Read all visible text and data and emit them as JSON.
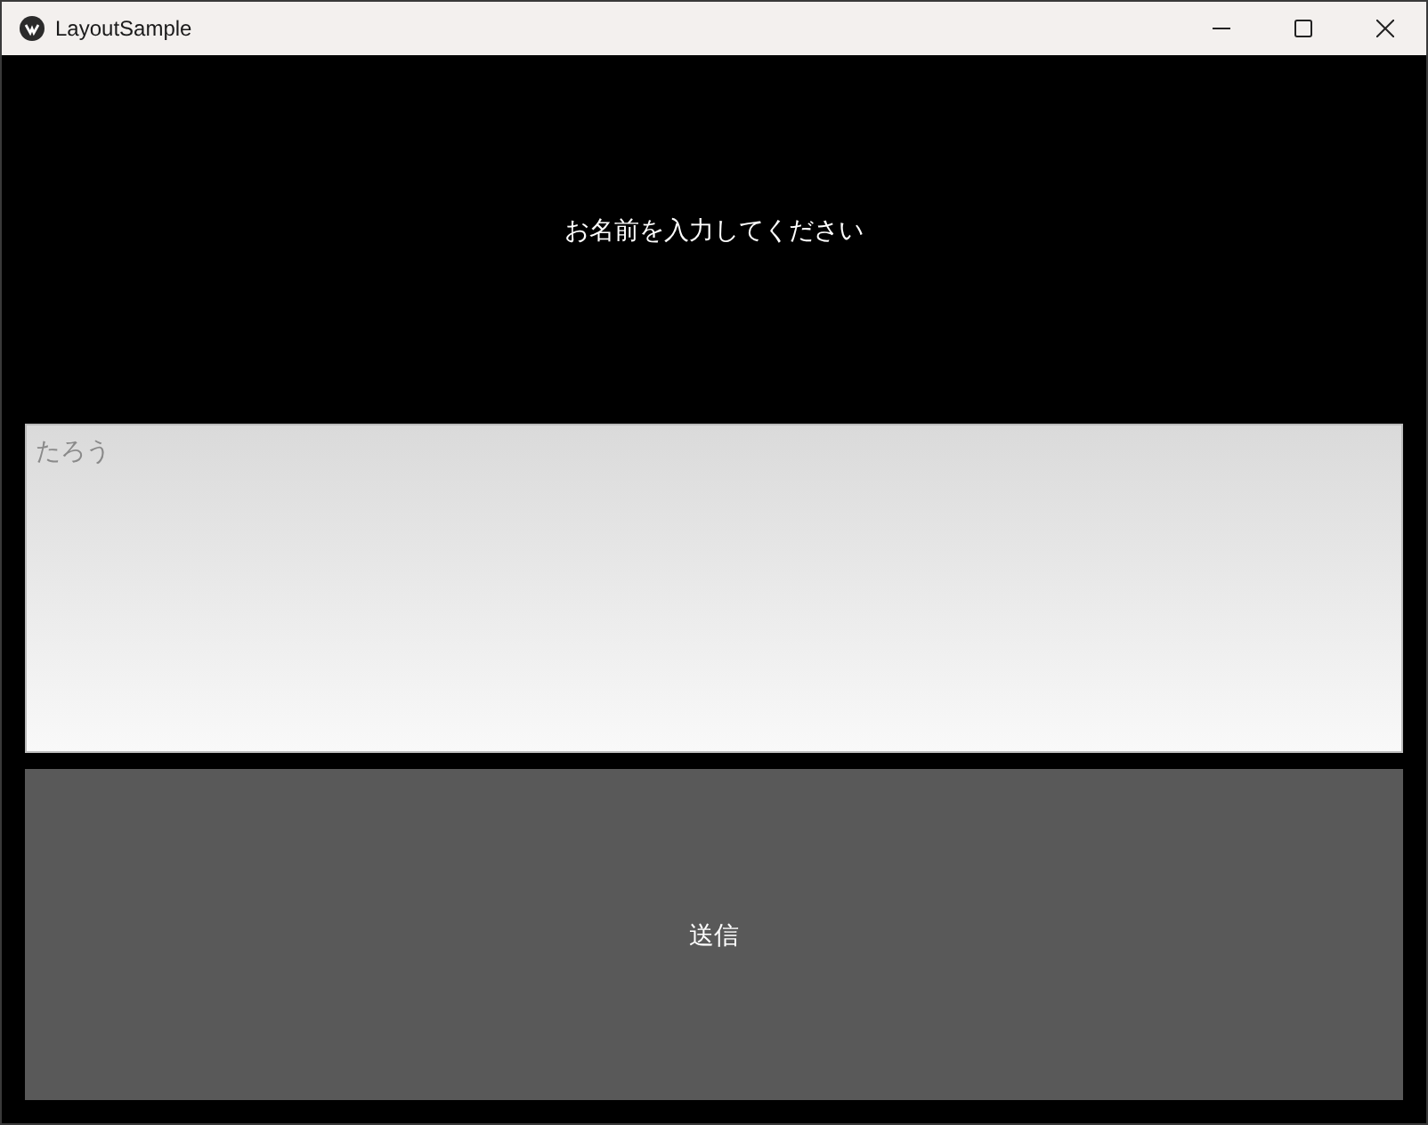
{
  "window": {
    "title": "LayoutSample"
  },
  "prompt": {
    "text": "お名前を入力してください"
  },
  "name_field": {
    "placeholder": "たろう"
  },
  "submit_button": {
    "label": "送信"
  }
}
